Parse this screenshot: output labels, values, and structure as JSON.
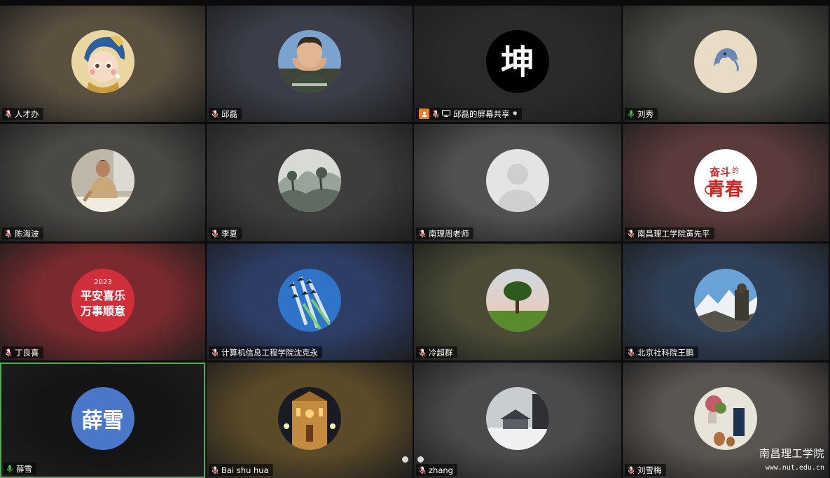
{
  "participants": [
    {
      "name": "人才办",
      "mic": "muted",
      "bg": "#5a5040",
      "avatar": "girl-pearl-earring"
    },
    {
      "name": "邱磊",
      "mic": "muted",
      "bg": "#3b3e48",
      "avatar": "boy-photo"
    },
    {
      "name": "邱磊的屏幕共享",
      "mic": "muted",
      "bg": "#2a2a2a",
      "avatar": "kun-calligraphy",
      "avatar_text": "坤",
      "screen_share": true
    },
    {
      "name": "刘秀",
      "mic": "on",
      "bg": "#4b4a44",
      "avatar": "dolphin-drawing"
    },
    {
      "name": "陈海波",
      "mic": "muted",
      "bg": "#4b4945",
      "avatar": "man-photo"
    },
    {
      "name": "李夏",
      "mic": "muted",
      "bg": "#3d3d3d",
      "avatar": "landscape-painting"
    },
    {
      "name": "南理周老师",
      "mic": "muted",
      "bg": "#505050",
      "avatar": "default-person"
    },
    {
      "name": "南昌理工学院黄先平",
      "mic": "muted",
      "bg": "#5a3a3a",
      "avatar": "youth-logo",
      "avatar_text": "奋斗的青春"
    },
    {
      "name": "丁良喜",
      "mic": "muted",
      "bg": "#7a2a2e",
      "avatar": "new-year-2023",
      "avatar_text": "2023 平安喜乐 万事顺意"
    },
    {
      "name": "计算机信息工程学院沈克永",
      "mic": "muted",
      "bg": "#2d3d66",
      "avatar": "jets-sky"
    },
    {
      "name": "冷超群",
      "mic": "muted",
      "bg": "#4a4a36",
      "avatar": "tree-field"
    },
    {
      "name": "北京社科院王鹏",
      "mic": "muted",
      "bg": "#2f3f55",
      "avatar": "mountain-photo"
    },
    {
      "name": "薛雪",
      "mic": "on",
      "bg": "#141414",
      "avatar": "initials",
      "avatar_text": "薛雪",
      "active": true
    },
    {
      "name": "Bai shu hua",
      "mic": "muted",
      "bg": "#5a4a28",
      "avatar": "cathedral-night"
    },
    {
      "name": "zhang",
      "mic": "muted",
      "bg": "#4a4a4a",
      "avatar": "snow-house"
    },
    {
      "name": "刘雪梅",
      "mic": "muted",
      "bg": "#5a5550",
      "avatar": "white-house-flowers"
    }
  ],
  "watermark": {
    "title": "南昌理工学院",
    "url": "www.nut.edu.cn"
  },
  "colors": {
    "active_border": "#4caf50",
    "mic_on": "#4caf50",
    "share_badge": "#ef7d23"
  }
}
